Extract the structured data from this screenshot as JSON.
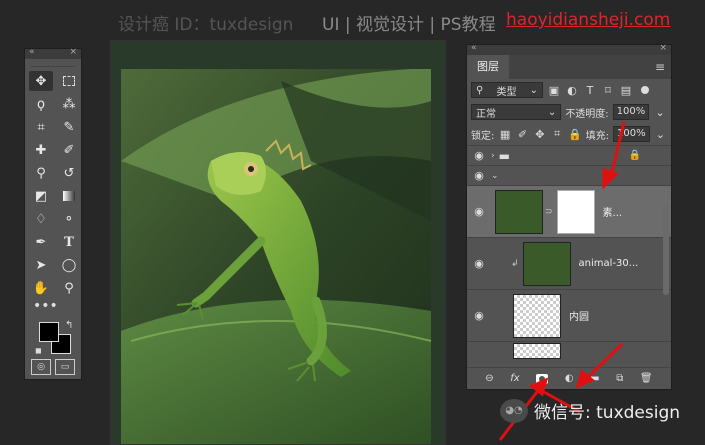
{
  "header": {
    "left": "设计癌 ID：tuxdesign",
    "center": "UI | 视觉设计 | PS教程",
    "url": "haoyidiansheji.com"
  },
  "tools": {
    "collapse_icon": "«",
    "close_icon": "×",
    "more_label": "•••"
  },
  "layers_panel": {
    "collapse_icon": "«",
    "close_icon": "×",
    "tab_label": "图层",
    "menu_icon": "≡",
    "filter_label": "类型",
    "blend_mode": "正常",
    "opacity_label": "不透明度:",
    "opacity_value": "100%",
    "lock_label": "锁定:",
    "fill_label": "填充:",
    "fill_value": "100%",
    "layers": [
      {
        "name": "素..."
      },
      {
        "name": "animal-30..."
      },
      {
        "name": "内圆"
      }
    ],
    "bottom_icons": [
      "link",
      "fx",
      "add-mask",
      "adjustment",
      "folder",
      "new-layer",
      "trash"
    ]
  },
  "watermark": {
    "text": "微信号: tuxdesign"
  },
  "colors": {
    "accent_red": "#e01010",
    "panel_bg": "#535353",
    "page_bg": "#272727"
  }
}
